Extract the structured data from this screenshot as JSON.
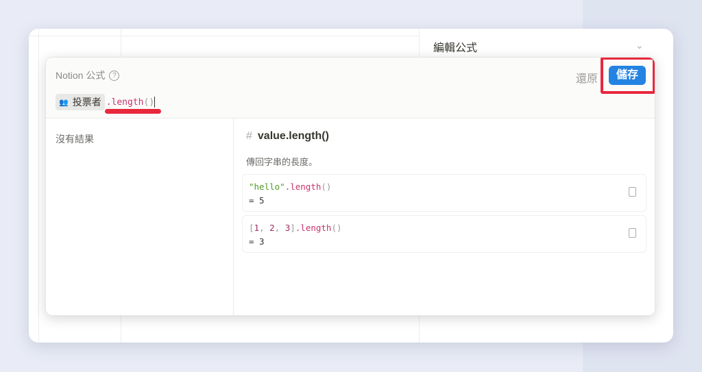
{
  "panel": {
    "title": "編輯公式",
    "chevron_icon": "chevron-down-icon"
  },
  "modal": {
    "title": "Notion 公式",
    "help_icon": "?",
    "revert_label": "還原",
    "save_label": "儲存",
    "formula": {
      "property_chip": "投票者",
      "method": ".length",
      "parens": "()"
    },
    "no_results": "沒有結果",
    "doc": {
      "hash": "#",
      "signature": "value.length()",
      "description": "傳回字串的長度。",
      "examples": [
        {
          "parts": {
            "s": "\"hello\"",
            "m": ".length",
            "p": "()"
          },
          "result": "= 5"
        },
        {
          "parts": {
            "b1": "[",
            "n1": "1",
            "c1": ", ",
            "n2": "2",
            "c2": ", ",
            "n3": "3",
            "b2": "]",
            "m": ".length",
            "p": "()"
          },
          "result": "= 3"
        }
      ]
    }
  },
  "colors": {
    "accent": "#2383e2",
    "highlight": "#e8283c",
    "code_method": "#c8336a",
    "code_string": "#4e9a26"
  }
}
